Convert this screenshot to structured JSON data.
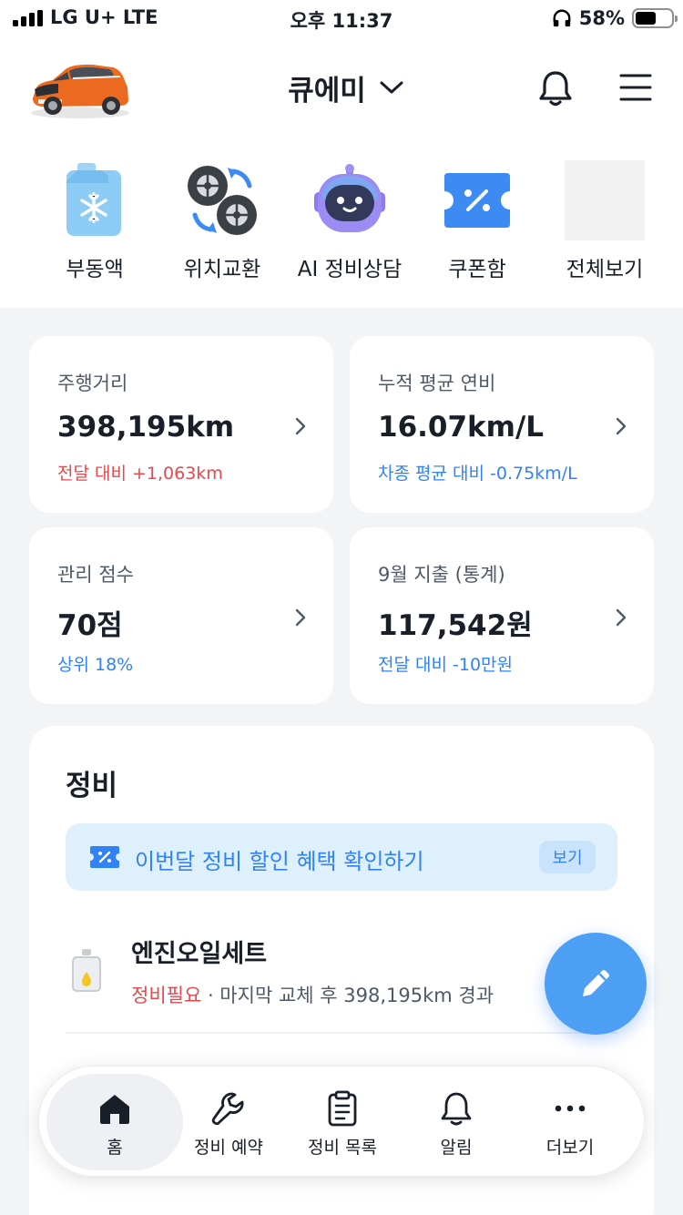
{
  "status_bar": {
    "carrier": "LG U+  LTE",
    "time": "오후 11:37",
    "battery_percent": "58%",
    "battery_level": 0.58
  },
  "header": {
    "car_name": "큐에미"
  },
  "quick_menu": [
    {
      "label": "부동액",
      "icon": "antifreeze-icon"
    },
    {
      "label": "위치교환",
      "icon": "tire-rotation-icon"
    },
    {
      "label": "AI 정비상담",
      "icon": "ai-robot-icon"
    },
    {
      "label": "쿠폰함",
      "icon": "coupon-icon"
    },
    {
      "label": "전체보기",
      "icon": "view-all-placeholder"
    }
  ],
  "stats": {
    "mileage": {
      "label": "주행거리",
      "value": "398,195km",
      "sub": "전달 대비 +1,063km"
    },
    "fuel": {
      "label": "누적 평균 연비",
      "value": "16.07km/L",
      "sub": "차종 평균 대비 -0.75km/L"
    },
    "score": {
      "label": "관리 점수",
      "value": "70점",
      "sub": "상위 18%"
    },
    "expense": {
      "label": "9월 지출 (통계)",
      "value": "117,542원",
      "sub": "전달 대비 -10만원"
    }
  },
  "colors": {
    "accent": "#3182f6",
    "negative": "#e5484d",
    "fab": "#4c9ff5"
  },
  "maintenance": {
    "title": "정비",
    "promo_text": "이번달 정비 할인 혜택 확인하기",
    "promo_button": "보기",
    "items": [
      {
        "name": "엔진오일세트",
        "status": "정비필요",
        "detail": " · 마지막 교체 후 398,195km 경과",
        "icon": "oil-bottle-icon"
      }
    ]
  },
  "tabs": [
    {
      "label": "홈",
      "icon": "home-icon"
    },
    {
      "label": "정비 예약",
      "icon": "wrench-icon"
    },
    {
      "label": "정비 목록",
      "icon": "clipboard-icon"
    },
    {
      "label": "알림",
      "icon": "bell-icon"
    },
    {
      "label": "더보기",
      "icon": "more-icon"
    }
  ]
}
